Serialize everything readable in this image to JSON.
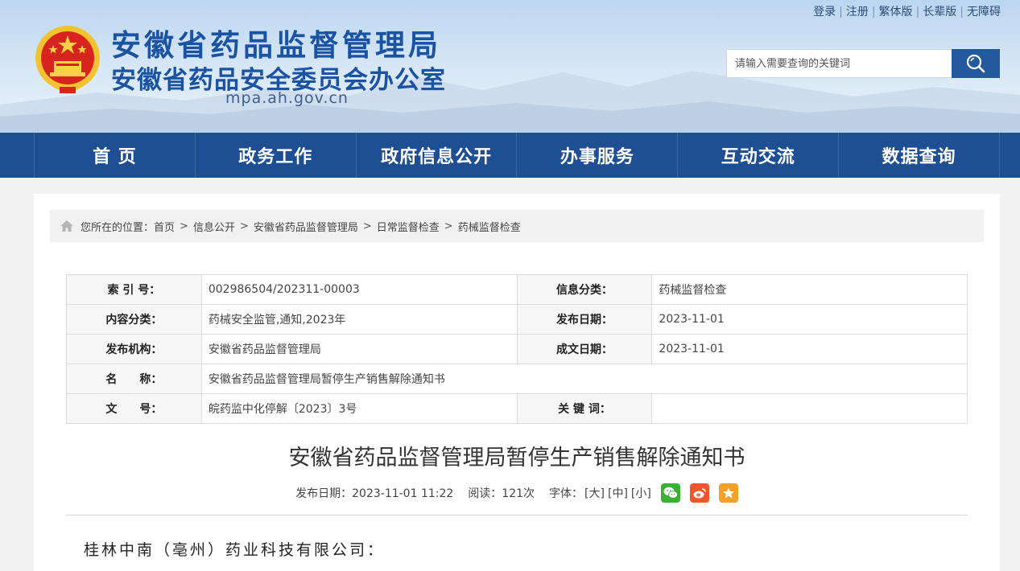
{
  "header": {
    "title_main": "安徽省药品监督管理局",
    "title_sub": "安徽省药品安全委员会办公室",
    "domain": "mpa.ah.gov.cn",
    "top_links": [
      "登录",
      "注册",
      "繁体版",
      "长辈版",
      "无障碍"
    ],
    "search_placeholder": "请输入需要查询的关键词"
  },
  "nav": [
    "首 页",
    "政务工作",
    "政府信息公开",
    "办事服务",
    "互动交流",
    "数据查询"
  ],
  "breadcrumb": {
    "prefix": "您所在的位置：",
    "items": [
      "首页",
      "信息公开",
      "安徽省药品监督管理局",
      "日常监督检查",
      "药械监督检查"
    ],
    "separator": ">"
  },
  "meta": {
    "index_label": "索 引 号：",
    "index_value": "002986504/202311-00003",
    "category_label": "信息分类：",
    "category_value": "药械监督检查",
    "content_label": "内容分类：",
    "content_value": "药械安全监管,通知,2023年",
    "pubdate_label": "发布日期：",
    "pubdate_value": "2023-11-01",
    "org_label": "发布机构：",
    "org_value": "安徽省药品监督管理局",
    "docdate_label": "成文日期：",
    "docdate_value": "2023-11-01",
    "name_label": "名　　称：",
    "name_value": "安徽省药品监督管理局暂停生产销售解除通知书",
    "docno_label": "文　　号：",
    "docno_value": "皖药监中化停解〔2023〕3号",
    "keyword_label": "关 键 词：",
    "keyword_value": ""
  },
  "article": {
    "title": "安徽省药品监督管理局暂停生产销售解除通知书",
    "publish": "发布日期：2023-11-01 11:22",
    "reads": "阅读：121次",
    "font_label": "字体：",
    "font_large": "[大]",
    "font_medium": "[中]",
    "font_small": "[小]",
    "body_first_line": "桂林中南（亳州）药业科技有限公司："
  },
  "colors": {
    "brand_blue": "#1d4f92",
    "title_blue": "#1b53a3",
    "wechat_green": "#3cb034",
    "weibo_orange": "#f0552e",
    "fav_orange": "#f7a028"
  }
}
